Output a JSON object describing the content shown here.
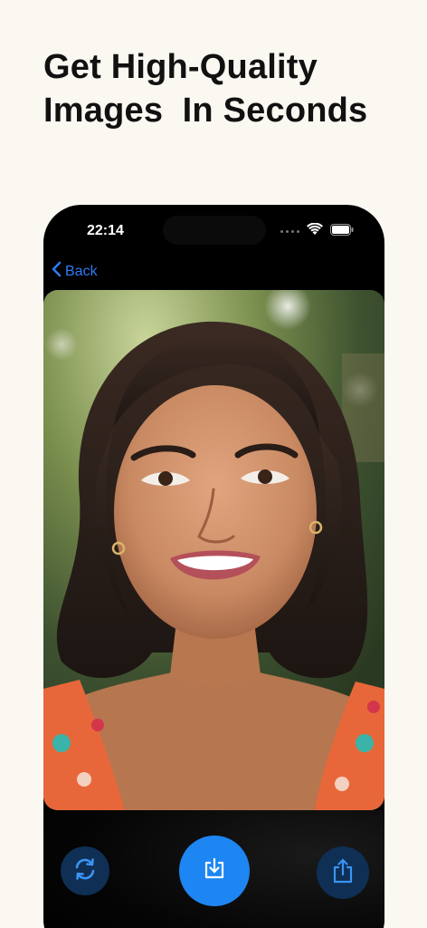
{
  "headline": {
    "line1": "Get High-Quality",
    "line2": "Images  In Seconds"
  },
  "phone": {
    "status_bar": {
      "time": "22:14",
      "icons": [
        "signal-dots-icon",
        "wifi-icon",
        "battery-icon"
      ]
    },
    "nav": {
      "back_label": "Back",
      "back_icon": "chevron-left-icon"
    },
    "actions": {
      "refresh_icon": "refresh-icon",
      "download_icon": "download-icon",
      "share_icon": "share-icon"
    }
  },
  "colors": {
    "page_background": "#fbf7f1",
    "accent_blue": "#1e86f2",
    "link_blue": "#2f7bf6",
    "dark_button": "#0f2f55",
    "phone_background": "#000000"
  }
}
